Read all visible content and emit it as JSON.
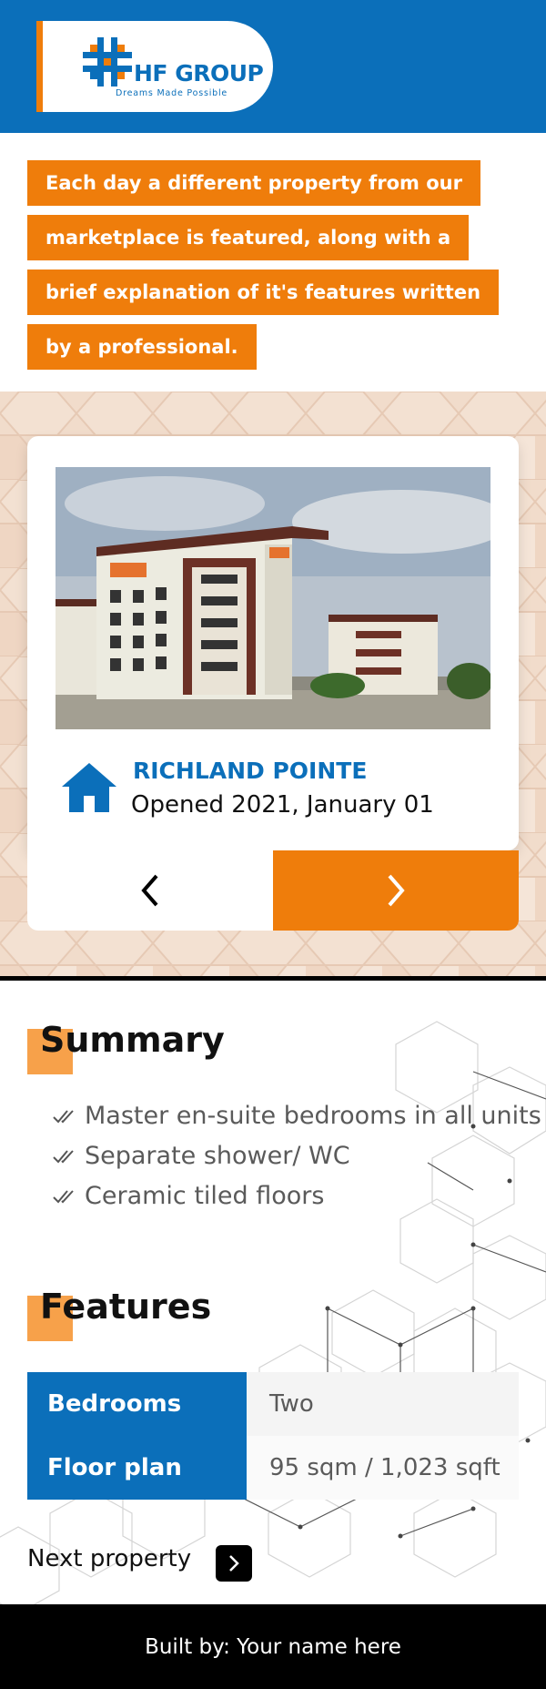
{
  "header": {
    "brand_name": "HF GROUP",
    "brand_tagline": "Dreams Made Possible",
    "brand_color": "#0b6fba",
    "accent_color": "#ef7d0b"
  },
  "intro": {
    "lines": [
      "Each day a different property from our",
      "marketplace is featured, along with a",
      "brief explanation of it's features written",
      "by a professional."
    ]
  },
  "featured": {
    "name": "RICHLAND POINTE",
    "opened": "Opened 2021, January 01",
    "photo_icon": "apartment-building-photo",
    "home_icon": "home-icon",
    "prev_icon": "chevron-left-icon",
    "next_icon": "chevron-right-icon"
  },
  "summary": {
    "title": "Summary",
    "items": [
      "Master en-suite bedrooms in all units",
      "Separate shower/ WC",
      "Ceramic tiled floors"
    ]
  },
  "features": {
    "title": "Features",
    "rows": [
      {
        "key": "Bedrooms",
        "value": "Two"
      },
      {
        "key": "Floor plan",
        "value": "95 sqm / 1,023 sqft"
      }
    ]
  },
  "next_property": {
    "label": "Next property"
  },
  "footer": {
    "text": "Built by: Your name here"
  }
}
